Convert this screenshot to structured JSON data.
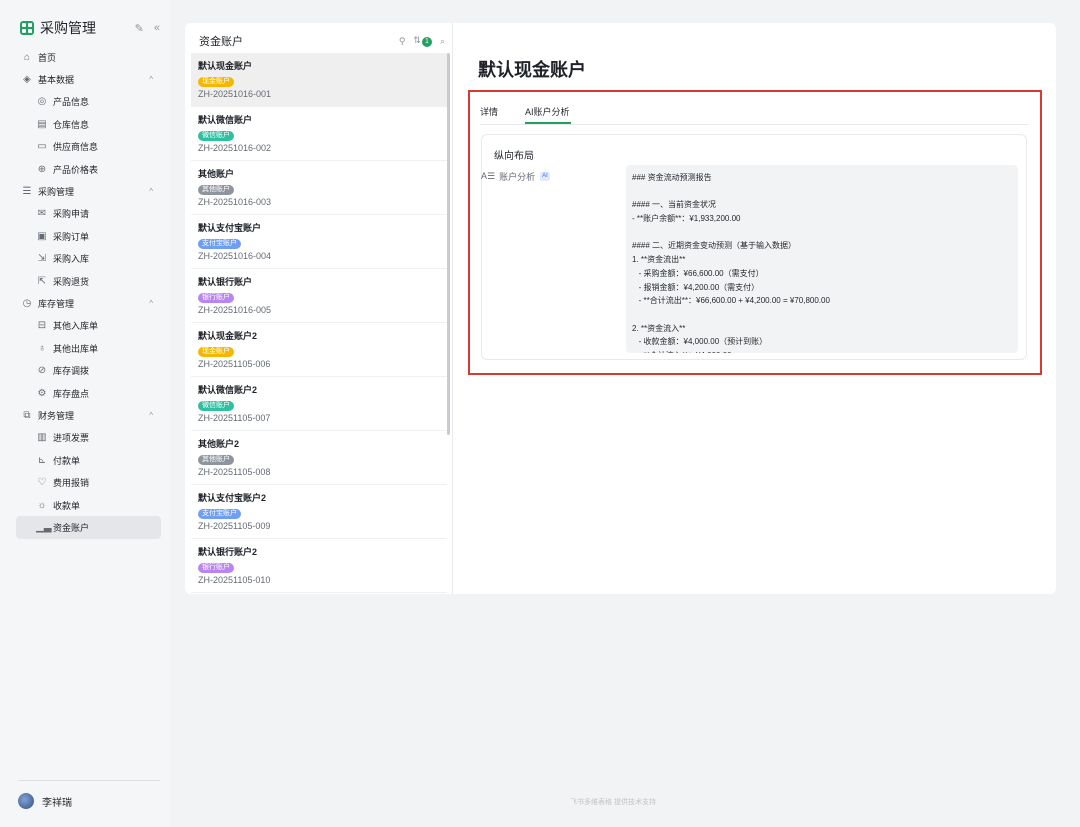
{
  "sidebar": {
    "app_title": "采购管理",
    "items": [
      {
        "kind": "group",
        "icon": "home-icon",
        "glyph": "⌂",
        "label": "首页",
        "chevron": ""
      },
      {
        "kind": "group",
        "icon": "database-icon",
        "glyph": "◈",
        "label": "基本数据",
        "chevron": "^"
      },
      {
        "kind": "child",
        "icon": "globe-icon",
        "glyph": "◎",
        "label": "产品信息"
      },
      {
        "kind": "child",
        "icon": "warehouse-icon",
        "glyph": "▤",
        "label": "仓库信息"
      },
      {
        "kind": "child",
        "icon": "monitor-icon",
        "glyph": "▭",
        "label": "供应商信息"
      },
      {
        "kind": "child",
        "icon": "price-icon",
        "glyph": "⊕",
        "label": "产品价格表"
      },
      {
        "kind": "group",
        "icon": "list-icon",
        "glyph": "☰",
        "label": "采购管理",
        "chevron": "^"
      },
      {
        "kind": "child",
        "icon": "mail-icon",
        "glyph": "✉",
        "label": "采购申请"
      },
      {
        "kind": "child",
        "icon": "calendar-icon",
        "glyph": "▣",
        "label": "采购订单"
      },
      {
        "kind": "child",
        "icon": "inbound-icon",
        "glyph": "⇲",
        "label": "采购入库"
      },
      {
        "kind": "child",
        "icon": "return-icon",
        "glyph": "⇱",
        "label": "采购退货"
      },
      {
        "kind": "group",
        "icon": "clock-icon",
        "glyph": "◷",
        "label": "库存管理",
        "chevron": "^"
      },
      {
        "kind": "child",
        "icon": "stock-in-icon",
        "glyph": "⊟",
        "label": "其他入库单"
      },
      {
        "kind": "child",
        "icon": "stock-out-icon",
        "glyph": "♁",
        "label": "其他出库单"
      },
      {
        "kind": "child",
        "icon": "transfer-icon",
        "glyph": "⊘",
        "label": "库存调拨"
      },
      {
        "kind": "child",
        "icon": "inventory-icon",
        "glyph": "⚙",
        "label": "库存盘点"
      },
      {
        "kind": "group",
        "icon": "finance-icon",
        "glyph": "⧉",
        "label": "财务管理",
        "chevron": "^"
      },
      {
        "kind": "child",
        "icon": "barcode-icon",
        "glyph": "▥",
        "label": "进项发票"
      },
      {
        "kind": "child",
        "icon": "payment-icon",
        "glyph": "⊾",
        "label": "付款单"
      },
      {
        "kind": "child",
        "icon": "reimburse-icon",
        "glyph": "♡",
        "label": "费用报销"
      },
      {
        "kind": "child",
        "icon": "receipt-icon",
        "glyph": "☼",
        "label": "收款单"
      },
      {
        "kind": "child",
        "icon": "chart-icon",
        "glyph": "▁▃",
        "label": "资金账户",
        "active": true
      }
    ],
    "user_name": "李祥瑞"
  },
  "list_panel": {
    "title": "资金账户",
    "sort_count": "1",
    "accounts": [
      {
        "name": "默认现金账户",
        "tag": "现金账户",
        "tag_color": "#f5b800",
        "code": "ZH-20251016-001",
        "selected": true
      },
      {
        "name": "默认微信账户",
        "tag": "微信账户",
        "tag_color": "#2ec0a0",
        "code": "ZH-20251016-002"
      },
      {
        "name": "其他账户",
        "tag": "其他账户",
        "tag_color": "#8f959e",
        "code": "ZH-20251016-003"
      },
      {
        "name": "默认支付宝账户",
        "tag": "支付宝账户",
        "tag_color": "#6f9ef5",
        "code": "ZH-20251016-004"
      },
      {
        "name": "默认银行账户",
        "tag": "银行账户",
        "tag_color": "#b986f0",
        "code": "ZH-20251016-005"
      },
      {
        "name": "默认现金账户2",
        "tag": "现金账户",
        "tag_color": "#f5b800",
        "code": "ZH-20251105-006"
      },
      {
        "name": "默认微信账户2",
        "tag": "微信账户",
        "tag_color": "#2ec0a0",
        "code": "ZH-20251105-007"
      },
      {
        "name": "其他账户2",
        "tag": "其他账户",
        "tag_color": "#8f959e",
        "code": "ZH-20251105-008"
      },
      {
        "name": "默认支付宝账户2",
        "tag": "支付宝账户",
        "tag_color": "#6f9ef5",
        "code": "ZH-20251105-009"
      },
      {
        "name": "默认银行账户2",
        "tag": "银行账户",
        "tag_color": "#b986f0",
        "code": "ZH-20251105-010"
      }
    ]
  },
  "detail": {
    "title": "默认现金账户",
    "tabs": [
      "详情",
      "AI账户分析"
    ],
    "section_title": "纵向布局",
    "field_label": "账户分析",
    "ai_badge": "AI",
    "analysis_lines": [
      "### 资金流动预测报告",
      "",
      "#### 一、当前资金状况",
      "- **账户余额**：¥1,933,200.00",
      "",
      "#### 二、近期资金变动预测（基于输入数据）",
      "1. **资金流出**",
      "   - 采购金额：¥66,600.00（需支付）",
      "   - 报销金额：¥4,200.00（需支付）",
      "   - **合计流出**：¥66,600.00 + ¥4,200.00 = ¥70,800.00",
      "",
      "2. **资金流入**",
      "   - 收款金额：¥4,000.00（预计到账）",
      "   - **合计流入**：¥4,000.00"
    ]
  },
  "footer_note": "飞书多维表格 提供技术支持",
  "colors": {
    "accent": "#20a162",
    "highlight_border": "#d83931"
  }
}
